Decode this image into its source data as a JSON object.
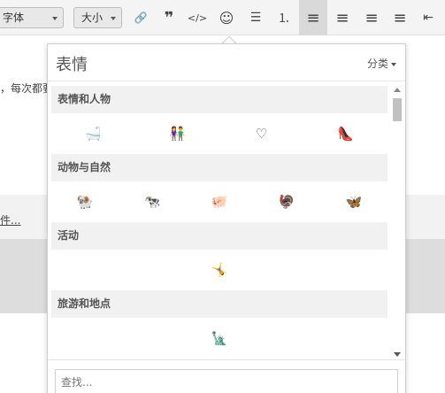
{
  "toolbar": {
    "font_select": "字体",
    "size_select": "大小",
    "buttons": [
      {
        "icon": "link-icon",
        "glyph": "🔗"
      },
      {
        "icon": "quote-icon",
        "glyph": "❞"
      },
      {
        "icon": "code-icon",
        "glyph": "</>"
      },
      {
        "icon": "emoji-icon",
        "glyph": "☺"
      },
      {
        "icon": "bullet-list-icon",
        "glyph": "☰"
      },
      {
        "icon": "numbered-list-icon",
        "glyph": "⒈"
      },
      {
        "icon": "align-left-icon",
        "glyph": "≡"
      },
      {
        "icon": "align-center-icon",
        "glyph": "≡"
      },
      {
        "icon": "align-right-icon",
        "glyph": "≡"
      },
      {
        "icon": "justify-icon",
        "glyph": "≡"
      },
      {
        "icon": "outdent-icon",
        "glyph": "⇤"
      }
    ]
  },
  "background": {
    "text_line": "，每次都要",
    "link_text": "件..."
  },
  "popup": {
    "title": "表情",
    "category_label": "分类",
    "search_placeholder": "查找...",
    "sections": [
      {
        "title": "表情和人物",
        "emojis": [
          "bathtub",
          "people",
          "heart",
          "high-heel"
        ],
        "glyphs": [
          "🛁",
          "👫",
          "♡",
          "👠"
        ]
      },
      {
        "title": "动物与自然",
        "emojis": [
          "ram",
          "cow",
          "pig",
          "turkey",
          "butterfly"
        ],
        "glyphs": [
          "🐏",
          "🐄",
          "🐖",
          "🦃",
          "🦋"
        ]
      },
      {
        "title": "活动",
        "emojis": [
          "sports"
        ],
        "glyphs": [
          "🤸"
        ]
      },
      {
        "title": "旅游和地点",
        "emojis": [
          "statue-of-liberty"
        ],
        "glyphs": [
          "🗽"
        ]
      }
    ]
  }
}
